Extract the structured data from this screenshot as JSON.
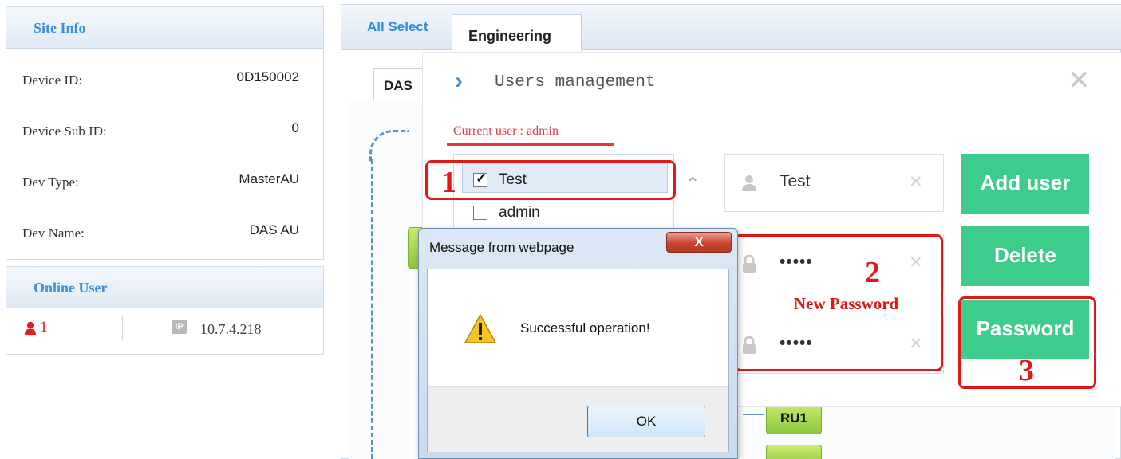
{
  "site_info": {
    "title": "Site Info",
    "rows": [
      {
        "label": "Device ID:",
        "value": "0D150002"
      },
      {
        "label": "Device Sub ID:",
        "value": "0"
      },
      {
        "label": "Dev Type:",
        "value": "MasterAU"
      },
      {
        "label": "Dev Name:",
        "value": "DAS AU"
      }
    ]
  },
  "online_user": {
    "title": "Online User",
    "count": "1",
    "ip_badge": "IP",
    "ip": "10.7.4.218"
  },
  "tabs": {
    "all_select": "All Select",
    "engineering": "Engineering",
    "das": "DAS"
  },
  "topology": {
    "ru1": "RU1"
  },
  "users_mgmt": {
    "title": "Users management",
    "close": "✕",
    "current_user": "Current user : admin",
    "users": [
      {
        "name": "Test",
        "checked": true
      },
      {
        "name": "admin",
        "checked": false
      }
    ],
    "username_value": "Test",
    "password_mask": "•••••",
    "confirm_mask": "•••••",
    "clear_glyph": "✕",
    "buttons": {
      "add_user": "Add user",
      "delete": "Delete",
      "password": "Password"
    },
    "annotations": {
      "step1": "1",
      "step2": "2",
      "step3": "3",
      "new_password": "New Password"
    }
  },
  "dialog": {
    "title": "Message from webpage",
    "close": "X",
    "message": "Successful operation!",
    "ok": "OK"
  },
  "colors": {
    "accent_blue": "#3a8fdc",
    "green_button": "#3dcc8b",
    "annotation_red": "#e01818"
  }
}
